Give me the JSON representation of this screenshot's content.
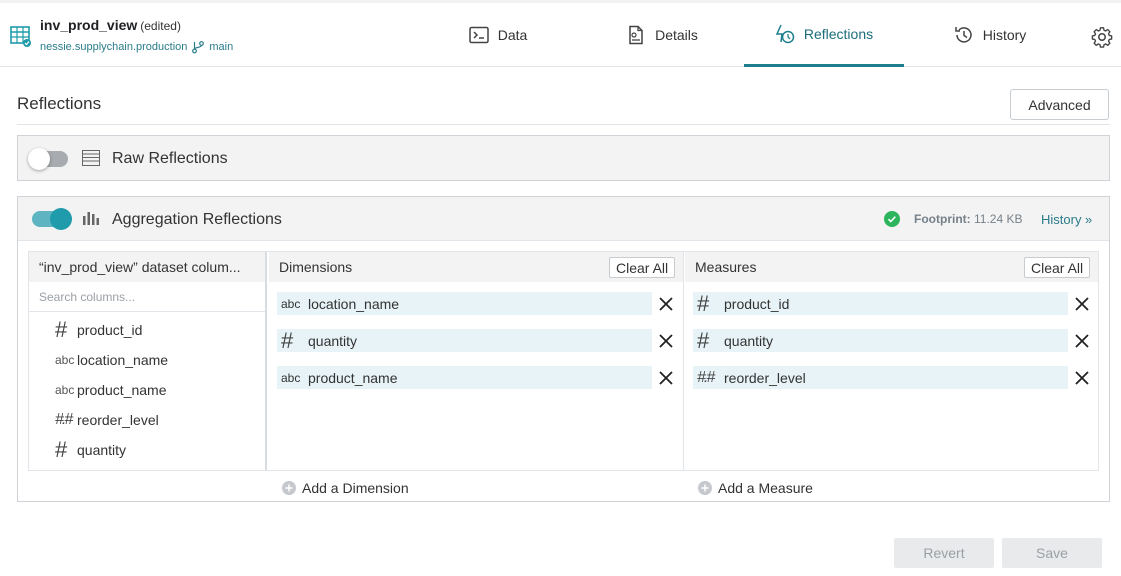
{
  "header": {
    "dataset_name": "inv_prod_view",
    "edited_label": "(edited)",
    "path": "nessie.supplychain.production",
    "branch": "main"
  },
  "tabs": [
    {
      "label": "Data",
      "icon": "terminal-icon"
    },
    {
      "label": "Details",
      "icon": "document-icon"
    },
    {
      "label": "Reflections",
      "icon": "reflections-icon",
      "active": true
    },
    {
      "label": "History",
      "icon": "history-icon"
    }
  ],
  "page": {
    "title": "Reflections",
    "advanced_label": "Advanced"
  },
  "raw": {
    "label": "Raw Reflections",
    "enabled": false
  },
  "aggregation": {
    "label": "Aggregation Reflections",
    "enabled": true,
    "footprint_label": "Footprint:",
    "footprint_value": "11.24 KB",
    "history_link": "History »",
    "dataset_pane": {
      "header": "“inv_prod_view” dataset colum...",
      "search_placeholder": "Search columns...",
      "columns": [
        {
          "type": "#",
          "name": "product_id"
        },
        {
          "type": "abc",
          "name": "location_name"
        },
        {
          "type": "abc",
          "name": "product_name"
        },
        {
          "type": "#.#",
          "name": "reorder_level"
        },
        {
          "type": "#",
          "name": "quantity"
        }
      ]
    },
    "dimensions": {
      "header": "Dimensions",
      "clear_label": "Clear All",
      "items": [
        {
          "type": "abc",
          "name": "location_name"
        },
        {
          "type": "#",
          "name": "quantity"
        },
        {
          "type": "abc",
          "name": "product_name"
        }
      ],
      "add_label": "Add a Dimension"
    },
    "measures": {
      "header": "Measures",
      "clear_label": "Clear All",
      "items": [
        {
          "type": "#",
          "name": "product_id"
        },
        {
          "type": "#",
          "name": "quantity"
        },
        {
          "type": "#.#",
          "name": "reorder_level"
        }
      ],
      "add_label": "Add a Measure"
    }
  },
  "footer": {
    "revert_label": "Revert",
    "save_label": "Save"
  },
  "colors": {
    "accent": "#1e7f8c",
    "toggle_on": "#1f9bab",
    "chip_bg": "#e7f3f6",
    "success": "#2db55d"
  }
}
